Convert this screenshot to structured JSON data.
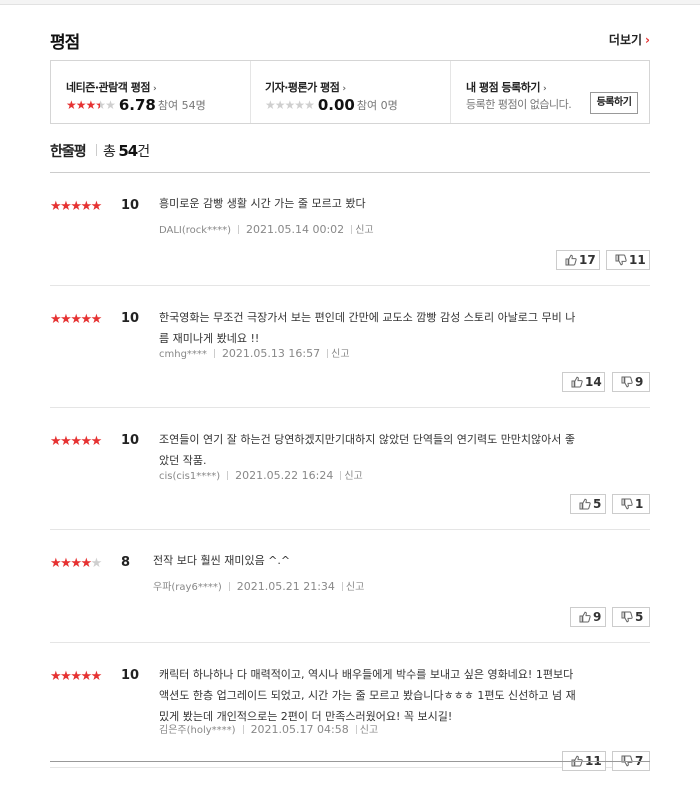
{
  "section": {
    "title": "평점",
    "more_label": "더보기",
    "more_arrow": "›"
  },
  "score_box": {
    "netizen": {
      "label": "네티즌·관람객 평점",
      "stars_on": 3,
      "stars_half": true,
      "stars_total": 5,
      "score": "6.78",
      "participants": "참여 54명"
    },
    "critic": {
      "label": "기자·평론가 평점",
      "stars_on": 0,
      "stars_half": false,
      "stars_total": 5,
      "score": "0.00",
      "participants": "참여 0명"
    },
    "mine": {
      "label": "내 평점 등록하기",
      "message": "등록한 평점이 없습니다.",
      "button_label": "등록하기"
    },
    "label_arrow": "›"
  },
  "comments_header": {
    "label": "한줄평",
    "total_prefix": "총",
    "total_count": "54",
    "total_suffix": "건"
  },
  "reviews": [
    {
      "stars": 5,
      "score": "10",
      "text_lines": [
        "흥미로운 감빵 생활 시간 가는 줄 모르고 봤다"
      ],
      "user": "DALI(rock****)",
      "date": "2021.05.14 00:02",
      "report": "신고",
      "likes": "17",
      "dislikes": "11"
    },
    {
      "stars": 5,
      "score": "10",
      "text_lines": [
        "한국영화는 무조건 극장가서 보는 편인데 간만에 교도소 깜빵 감성 스토리 아날로그 무비 나",
        "름 재미나게 봤네요 !!"
      ],
      "user": "cmhg****",
      "date": "2021.05.13 16:57",
      "report": "신고",
      "likes": "14",
      "dislikes": "9"
    },
    {
      "stars": 5,
      "score": "10",
      "text_lines": [
        "조연들이 연기 잘 하는건 당연하겠지만기대하지 않았던 단역들의 연기력도 만만치않아서 좋",
        "았던 작품."
      ],
      "user": "cis(cis1****)",
      "date": "2021.05.22 16:24",
      "report": "신고",
      "likes": "5",
      "dislikes": "1"
    },
    {
      "stars": 4,
      "score": "8",
      "text_lines": [
        "전작 보다 훨씬 재미있음 ^.^"
      ],
      "user": "우파(ray6****)",
      "date": "2021.05.21 21:34",
      "report": "신고",
      "likes": "9",
      "dislikes": "5"
    },
    {
      "stars": 5,
      "score": "10",
      "text_lines": [
        "캐릭터 하나하나 다 매력적이고, 역시나 배우들에게 박수를 보내고 싶은 영화네요! 1편보다",
        "액션도 한층 업그레이드 되었고, 시간 가는 줄 모르고 봤습니다ㅎㅎㅎ 1편도 신선하고 넘 재",
        "밌게 봤는데 개인적으로는 2편이 더 만족스러웠어요! 꼭 보시길!"
      ],
      "user": "김은주(holy****)",
      "date": "2021.05.17 04:58",
      "report": "신고",
      "likes": "11",
      "dislikes": "7"
    }
  ],
  "colors": {
    "star_on": "#e63232",
    "star_off": "#cfcfcf",
    "accent": "#e63232"
  }
}
